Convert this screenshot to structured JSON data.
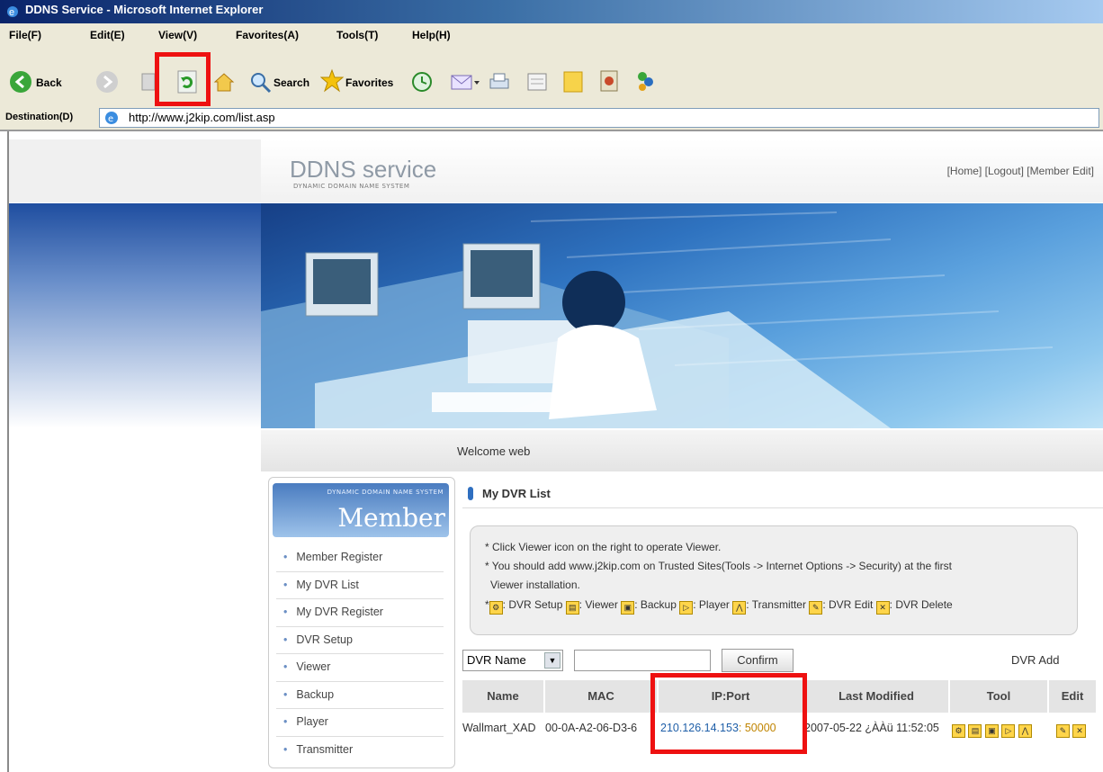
{
  "window": {
    "title": "DDNS Service - Microsoft Internet Explorer"
  },
  "menu": [
    "File(F)",
    "Edit(E)",
    "View(V)",
    "Favorites(A)",
    "Tools(T)",
    "Help(H)"
  ],
  "toolbar": {
    "back": "Back",
    "search": "Search",
    "favorites": "Favorites"
  },
  "address": {
    "label": "Destination(D)",
    "url": "http://www.j2kip.com/list.asp"
  },
  "header": {
    "logo": "DDNS service",
    "logo_sub": "DYNAMIC DOMAIN NAME SYSTEM",
    "links": "[Home] [Logout] [Member Edit]"
  },
  "welcome": "Welcome web",
  "sidebar": {
    "small": "DYNAMIC DOMAIN NAME SYSTEM",
    "title": "Member",
    "items": [
      "Member Register",
      "My DVR List",
      "My DVR Register",
      "DVR Setup",
      "Viewer",
      "Backup",
      "Player",
      "Transmitter"
    ]
  },
  "section": {
    "title": "My DVR List"
  },
  "notice": {
    "line1": "* Click Viewer icon on the right to operate Viewer.",
    "line2": "* You should add www.j2kip.com on Trusted Sites(Tools -> Internet Options -> Security) at the first",
    "line3": "Viewer installation.",
    "legend": [
      ": DVR Setup",
      ": Viewer",
      ": Backup",
      ": Player",
      ": Transmitter",
      ": DVR Edit",
      ": DVR Delete"
    ]
  },
  "filter": {
    "select": "DVR Name",
    "confirm": "Confirm",
    "add": "DVR Add"
  },
  "table": {
    "headers": [
      "Name",
      "MAC",
      "IP:Port",
      "Last Modified",
      "Tool",
      "Edit"
    ],
    "row": {
      "name": "Wallmart_XAD",
      "mac": "00-0A-A2-06-D3-6",
      "ip": "210.126.14.153",
      "port": "50000",
      "modified": "2007-05-22 ¿ÀÀü 11:52:05"
    }
  },
  "colors": {
    "highlight": "#ee1111",
    "ip": "#1f5fa8",
    "port": "#c08400"
  }
}
